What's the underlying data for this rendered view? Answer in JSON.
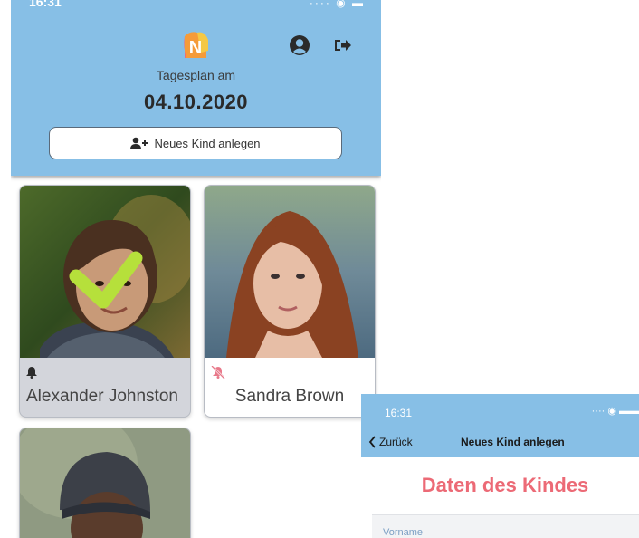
{
  "main_screen": {
    "status_time": "16:31",
    "logo_letter": "N",
    "icons": {
      "profile": "user-circle-icon",
      "logout": "sign-out-icon",
      "add_user": "user-plus-icon",
      "bell": "bell-icon",
      "bell_off": "bell-slash-icon",
      "check": "check-mark-icon"
    },
    "tagesplan_label": "Tagesplan am",
    "date": "04.10.2020",
    "new_child_button": "Neues Kind anlegen",
    "children": [
      {
        "name": "Alexander Johnston",
        "present": true,
        "notifications": "on"
      },
      {
        "name": "Sandra Brown",
        "present": false,
        "notifications": "off"
      },
      {
        "name": "",
        "present": true,
        "notifications": ""
      }
    ],
    "colors": {
      "header": "#87bfe6",
      "check": "#b6e03b",
      "bell_off": "#e8798a",
      "present_card": "#d3d5db"
    }
  },
  "form_screen": {
    "status_time": "16:31",
    "back_label": "Zurück",
    "title": "Neues Kind anlegen",
    "section_title": "Daten des Kindes",
    "fields": [
      {
        "label": "Vorname",
        "value": ""
      }
    ],
    "colors": {
      "section_title": "#ec6a76"
    }
  }
}
